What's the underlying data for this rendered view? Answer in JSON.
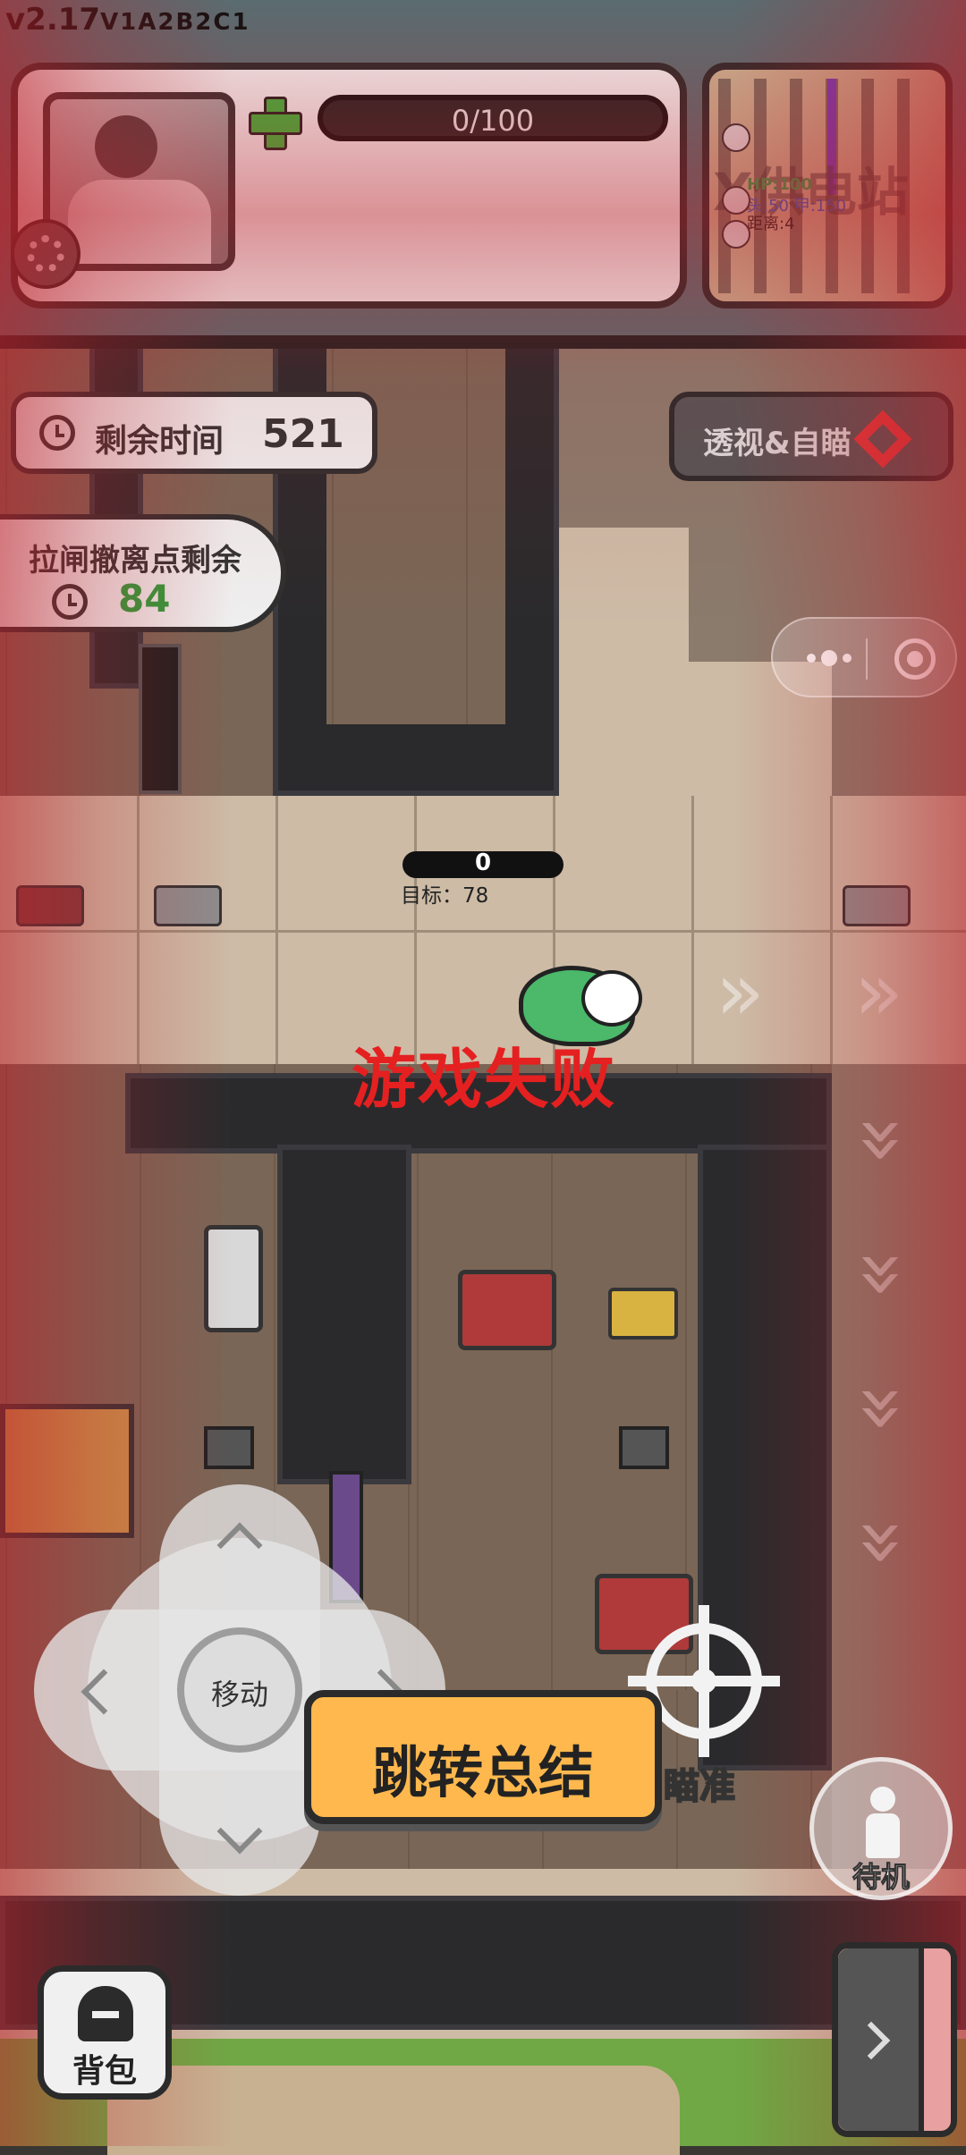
{
  "version": {
    "main": "v2.17",
    "build": "V1A2B2C1"
  },
  "player": {
    "health_text": "0/100"
  },
  "minimap": {
    "label_title": "X供电站",
    "hp_text": "HP:100",
    "stats_text": "头:50 甲:150",
    "distance_text": "距离:4"
  },
  "timers": {
    "remaining_label": "剩余时间",
    "remaining_value": "521",
    "evac_label": "拉闸撤离点剩余",
    "evac_value": "84"
  },
  "cheat_button": {
    "label": "透视&自瞄"
  },
  "target": {
    "score": "0",
    "goal_label": "目标：78"
  },
  "game_status": {
    "message": "游戏失败"
  },
  "controls": {
    "move_label": "移动",
    "aim_label": "瞄准",
    "idle_label": "待机",
    "backpack_label": "背包"
  },
  "summary_button": {
    "label": "跳转总结"
  },
  "colors": {
    "fail_text": "#e52020",
    "health_plus": "#3cb53c",
    "summary_bg": "#ffb84d",
    "timer_green": "#2e9e3c",
    "cheat_arrow": "#e0393b"
  }
}
